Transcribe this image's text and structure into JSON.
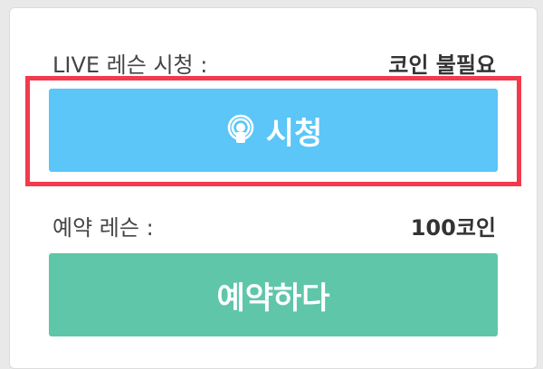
{
  "live_lesson": {
    "label": "LIVE 레슨 시청 :",
    "value": "코인 불필요",
    "button_label": "시청",
    "button_icon": "live-broadcast-icon",
    "highlight_color": "#f23a4d",
    "button_color": "#5bc6f7"
  },
  "reserved_lesson": {
    "label": "예약 레슨 :",
    "value": "100코인",
    "button_label": "예약하다",
    "button_color": "#5fc6a9"
  }
}
